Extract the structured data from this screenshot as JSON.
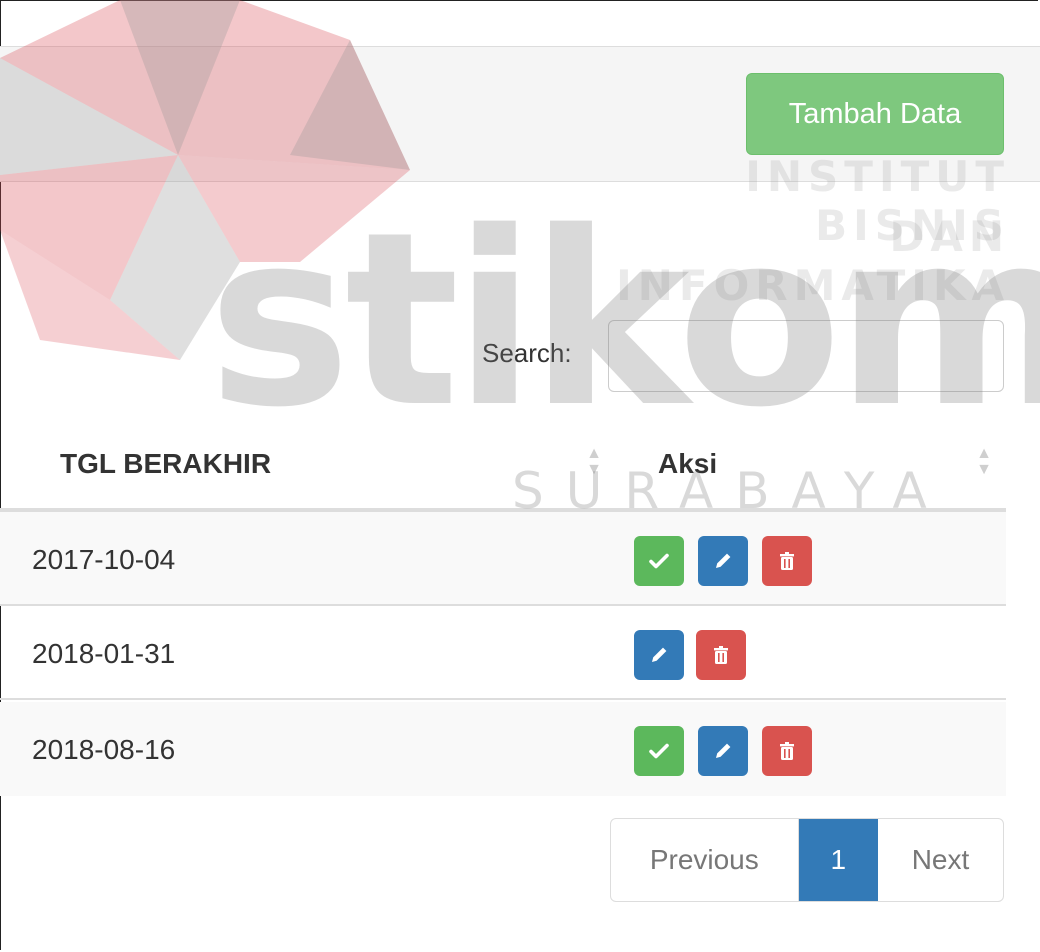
{
  "toolbar": {
    "add_label": "Tambah Data"
  },
  "search": {
    "label": "Search:",
    "value": "",
    "placeholder": ""
  },
  "table": {
    "columns": [
      "TGL BERAKHIR",
      "Aksi"
    ],
    "rows": [
      {
        "date": "2017-10-04",
        "actions": [
          "approve",
          "edit",
          "delete"
        ]
      },
      {
        "date": "2018-01-31",
        "actions": [
          "edit",
          "delete"
        ]
      },
      {
        "date": "2018-08-16",
        "actions": [
          "approve",
          "edit",
          "delete"
        ]
      }
    ]
  },
  "pagination": {
    "previous": "Previous",
    "current": "1",
    "next": "Next"
  },
  "watermark": {
    "line1": "INSTITUT BISNIS",
    "line2": "DAN INFORMATIKA",
    "brand": "stikom",
    "city": "SURABAYA"
  },
  "colors": {
    "success": "#5cb85c",
    "primary": "#337ab7",
    "danger": "#d9534f",
    "add_button": "#7ec87e"
  },
  "icons": {
    "approve": "check-icon",
    "edit": "pencil-icon",
    "delete": "trash-icon"
  }
}
